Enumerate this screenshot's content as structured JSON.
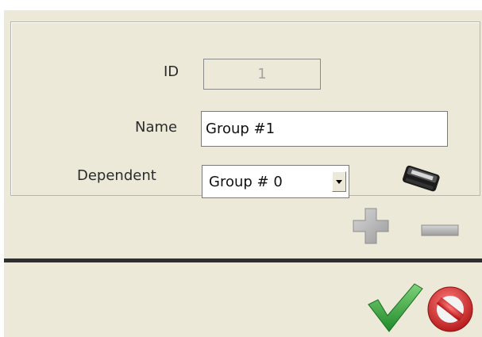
{
  "form": {
    "id_label": "ID",
    "id_value": "1",
    "name_label": "Name",
    "name_value": "Group #1",
    "dependent_label": "Dependent",
    "dependent_selected": "Group # 0"
  },
  "icons": {
    "edit_dependent": "cassette-tape-icon",
    "add": "plus-icon",
    "remove": "minus-icon",
    "ok": "checkmark-icon",
    "cancel": "cancel-icon"
  },
  "colors": {
    "panel_bg": "#ece9d8",
    "check_green": "#3aa33a",
    "cancel_red": "#d42424",
    "disabled_gray": "#b8b8b8"
  }
}
